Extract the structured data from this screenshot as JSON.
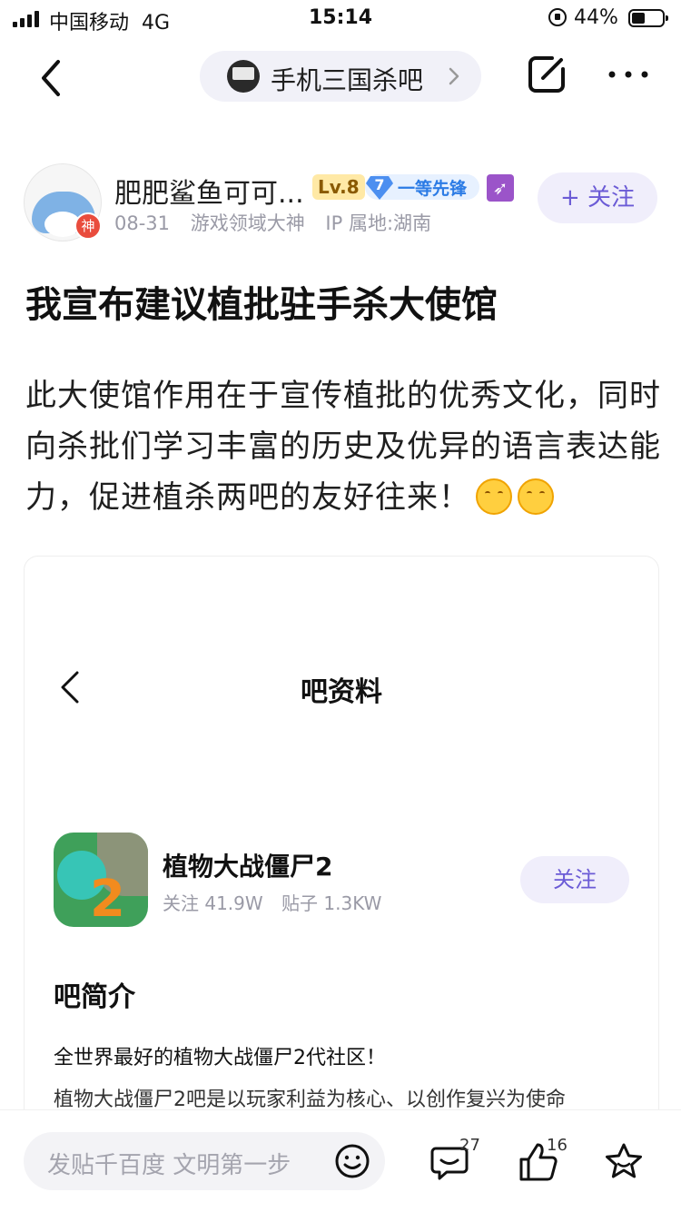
{
  "status_bar": {
    "carrier": "中国移动",
    "network": "4G",
    "time": "15:14",
    "battery": "44%"
  },
  "nav": {
    "forum_name": "手机三国杀吧"
  },
  "author": {
    "name": "肥肥鲨鱼可可...",
    "level": "Lv.8",
    "rank_num": "7",
    "rank_title": "一等先锋",
    "god_badge": "神",
    "date": "08-31",
    "honor": "游戏领域大神",
    "ip": "IP 属地:湖南",
    "follow_label": "+ 关注"
  },
  "post": {
    "title": "我宣布建议植批驻手杀大使馆",
    "body": "此大使馆作用在于宣传植批的优秀文化，同时向杀批们学习丰富的历史及优异的语言表达能力，促进植杀两吧的友好往来！"
  },
  "embedded": {
    "page_title": "吧资料",
    "forum_name": "植物大战僵尸2",
    "followers": "关注 41.9W",
    "posts": "贴子 1.3KW",
    "follow_label": "关注",
    "intro_heading": "吧简介",
    "intro_line1": "全世界最好的植物大战僵尸2代社区！",
    "intro_line2": "植物大战僵尸2吧是以玩家利益为核心、以创作复兴为使命"
  },
  "bottom_bar": {
    "reply_placeholder": "发贴千百度 文明第一步",
    "comment_count": "27",
    "like_count": "16"
  }
}
